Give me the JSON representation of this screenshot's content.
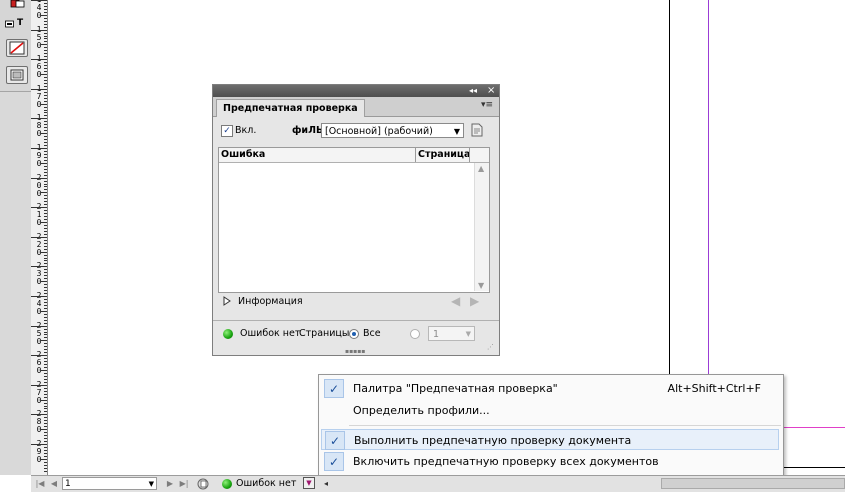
{
  "panel": {
    "tab_label": "Предпечатная проверка",
    "enable_label": "Вкл.",
    "profile_label": "фиЛЬ:",
    "profile_value": "[Основной] (рабочий)",
    "col_error": "Ошибка",
    "col_page": "Страница",
    "info_label": "Информация",
    "status_text": "Ошибок нет",
    "pages_label": "Страницы:",
    "pages_all": "Все",
    "page_range_value": "1"
  },
  "menu": {
    "items": [
      {
        "label": "Палитра \"Предпечатная проверка\"",
        "shortcut": "Alt+Shift+Ctrl+F",
        "checked": true
      },
      {
        "label": "Определить профили...",
        "shortcut": "",
        "checked": false
      },
      {
        "label": "Выполнить предпечатную проверку документа",
        "shortcut": "",
        "checked": true
      },
      {
        "label": "Включить предпечатную проверку всех документов",
        "shortcut": "",
        "checked": true
      }
    ]
  },
  "ruler": {
    "labels": [
      "140",
      "150",
      "160",
      "170",
      "180",
      "190",
      "200",
      "210",
      "220",
      "230",
      "240",
      "250",
      "260",
      "270",
      "280",
      "290"
    ]
  },
  "statusbar": {
    "page_number": "1",
    "status_text": "Ошибок нет"
  },
  "colors": {
    "preflight_ok": "#18a30f",
    "margin_guide": "#9b3cd6",
    "bleed_guide": "#e040c8",
    "menu_check": "#1b4f9a"
  }
}
